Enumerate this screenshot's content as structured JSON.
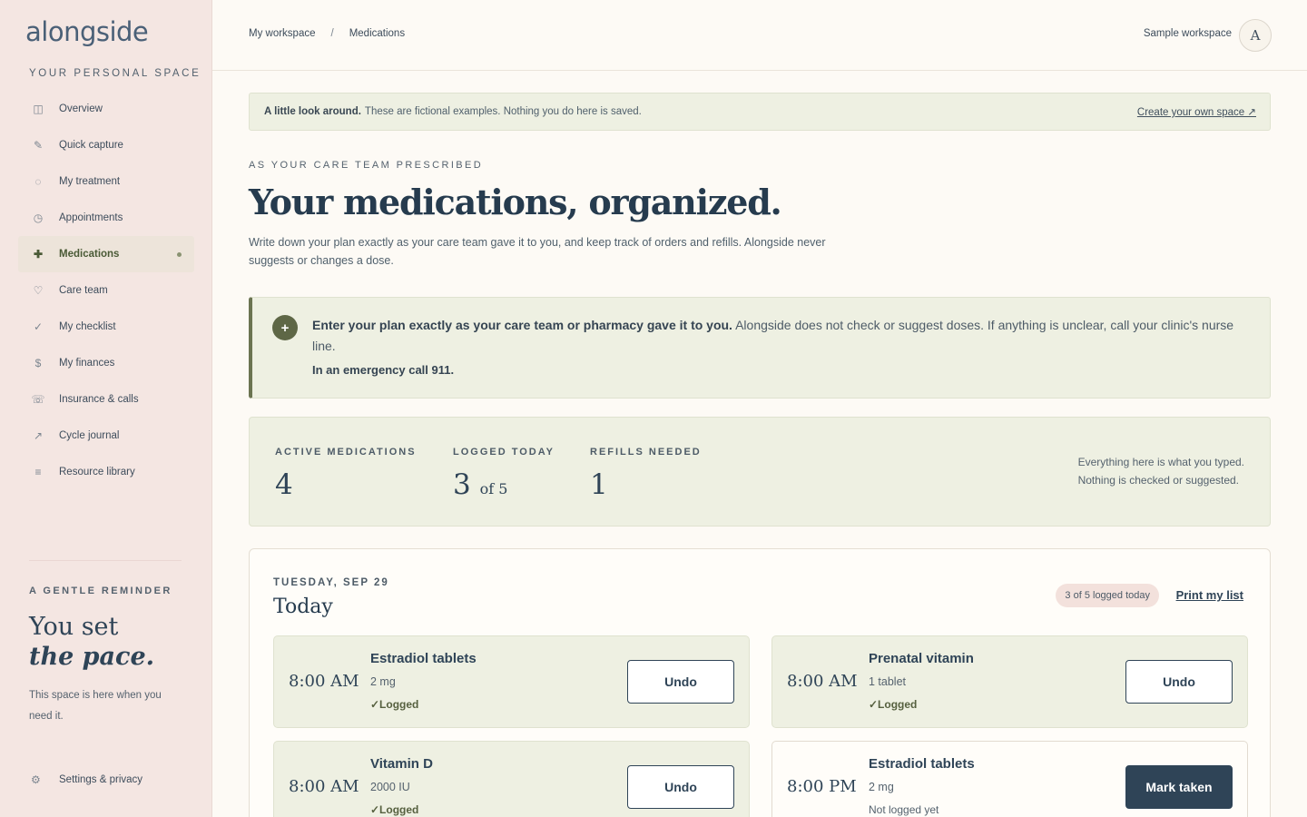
{
  "sidebar": {
    "logo": "alongside",
    "tagline": "YOUR PERSONAL SPACE",
    "items": [
      {
        "label": "Overview",
        "icon": "layout-icon",
        "glyph": "◫"
      },
      {
        "label": "Quick capture",
        "icon": "pencil-icon",
        "glyph": "✎"
      },
      {
        "label": "My treatment",
        "icon": "circle-icon",
        "glyph": "◌"
      },
      {
        "label": "Appointments",
        "icon": "clock-icon",
        "glyph": "◷"
      },
      {
        "label": "Medications",
        "icon": "plus-icon",
        "glyph": "✚"
      },
      {
        "label": "Care team",
        "icon": "heart-icon",
        "glyph": "♡"
      },
      {
        "label": "My checklist",
        "icon": "check-icon",
        "glyph": "✓"
      },
      {
        "label": "My finances",
        "icon": "dollar-icon",
        "glyph": "$"
      },
      {
        "label": "Insurance & calls",
        "icon": "phone-icon",
        "glyph": "☏"
      },
      {
        "label": "Cycle journal",
        "icon": "trend-icon",
        "glyph": "↗"
      },
      {
        "label": "Resource library",
        "icon": "list-icon",
        "glyph": "≡"
      }
    ],
    "reminder_label": "A GENTLE REMINDER",
    "reminder_title_1": "You set",
    "reminder_title_2": "the pace.",
    "reminder_text": "This space is here when you need it.",
    "settings_label": "Settings & privacy",
    "settings_glyph": "⚙"
  },
  "topbar": {
    "crumb_1": "My workspace",
    "crumb_sep": "/",
    "crumb_2": "Medications",
    "workspace": "Sample workspace",
    "avatar": "A"
  },
  "banner": {
    "bold": "A little look around.",
    "text": "These are fictional examples. Nothing you do here is saved.",
    "link": "Create your own space ↗"
  },
  "header": {
    "eyebrow": "AS YOUR CARE TEAM PRESCRIBED",
    "title": "Your medications, organized.",
    "lede": "Write down your plan exactly as your care team gave it to you, and keep track of orders and refills. Alongside never suggests or changes a dose."
  },
  "callout": {
    "bold": "Enter your plan exactly as your care team or pharmacy gave it to you.",
    "text": "Alongside does not check or suggest doses. If anything is unclear, call your clinic's nurse line.",
    "emergency": "In an emergency call 911."
  },
  "stats": {
    "active_label": "ACTIVE MEDICATIONS",
    "active_value": "4",
    "logged_label": "LOGGED TODAY",
    "logged_value": "3",
    "logged_of": "of 5",
    "refills_label": "REFILLS NEEDED",
    "refills_value": "1",
    "note_1": "Everything here is what you typed.",
    "note_2": "Nothing is checked or suggested."
  },
  "today": {
    "date": "TUESDAY, SEP 29",
    "title": "Today",
    "pill": "3 of 5 logged today",
    "print": "Print my list",
    "doses": [
      {
        "time": "8:00 AM",
        "name": "Estradiol tablets",
        "amount": "2 mg",
        "status": "✓Logged",
        "button": "Undo"
      },
      {
        "time": "8:00 AM",
        "name": "Prenatal vitamin",
        "amount": "1 tablet",
        "status": "✓Logged",
        "button": "Undo"
      },
      {
        "time": "8:00 AM",
        "name": "Vitamin D",
        "amount": "2000 IU",
        "status": "✓Logged",
        "button": "Undo"
      },
      {
        "time": "8:00 PM",
        "name": "Estradiol tablets",
        "amount": "2 mg",
        "status": "Not logged yet",
        "button": "Mark taken"
      }
    ]
  },
  "colors": {
    "accent": "#2f4457",
    "sidebar_bg": "#f4e6e2",
    "olive": "#5e6746",
    "panel": "#eef0e2"
  }
}
